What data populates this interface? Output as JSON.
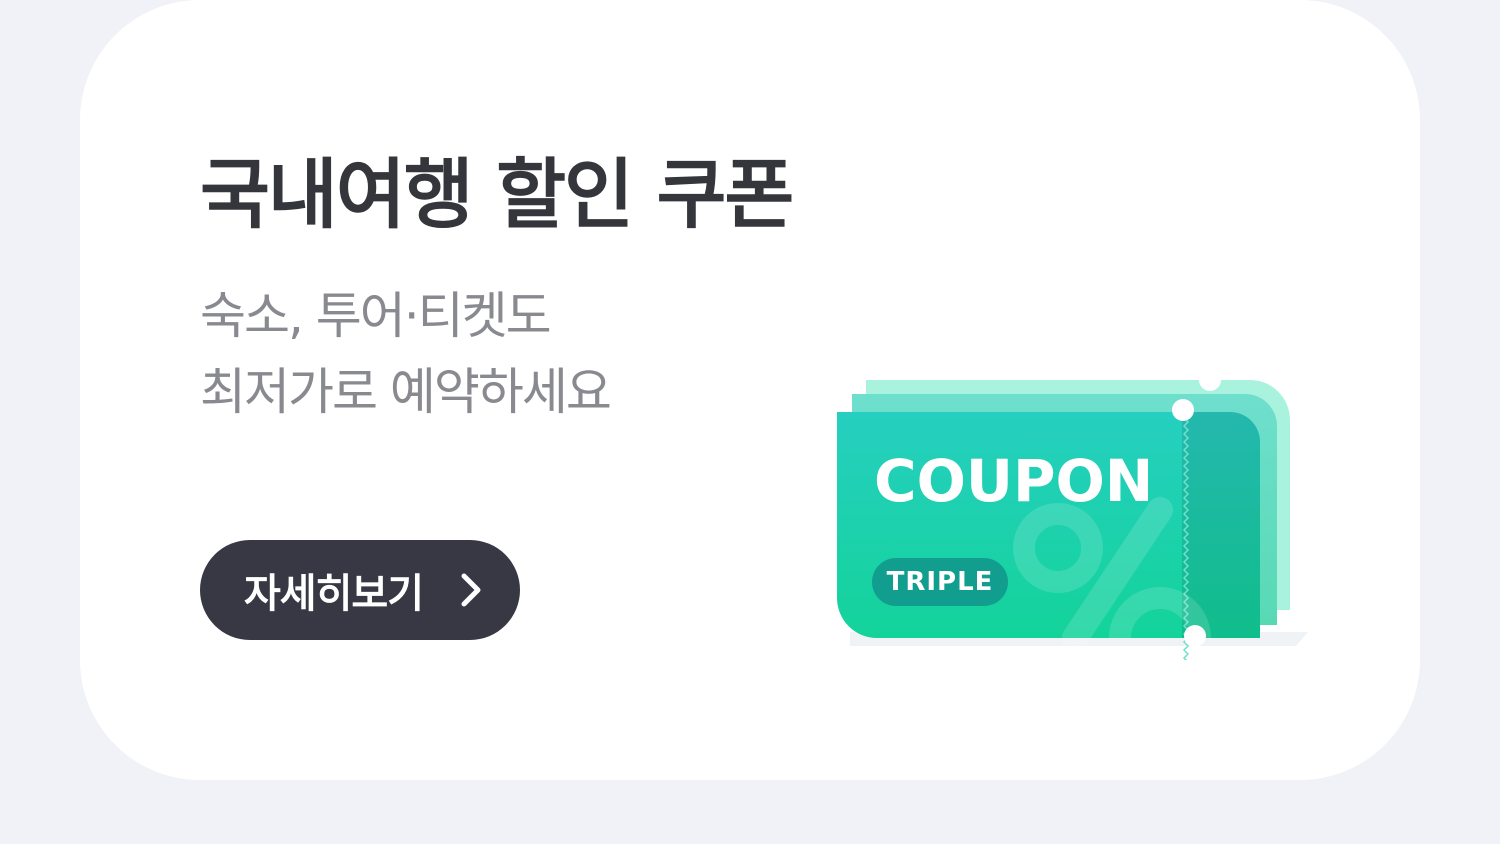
{
  "banner": {
    "title": "국내여행 할인 쿠폰",
    "subtitle_lines": [
      "숙소, 투어·티켓도",
      "최저가로 예약하세요"
    ],
    "button": {
      "label": "자세히보기",
      "icon": "chevron-right-icon"
    }
  },
  "coupon": {
    "word": "COUPON",
    "badge": "TRIPLE",
    "colors": {
      "front_top": "#26cfc0",
      "front_bottom": "#13d39a",
      "stub": "#1dbba0",
      "back_layer": "#a8f2de",
      "badge_bg": "#129e8e"
    }
  },
  "colors": {
    "page_bg": "#f0f2f8",
    "card_bg": "#ffffff",
    "title": "#35363b",
    "subtitle": "#888a90",
    "button_bg": "#373844"
  }
}
